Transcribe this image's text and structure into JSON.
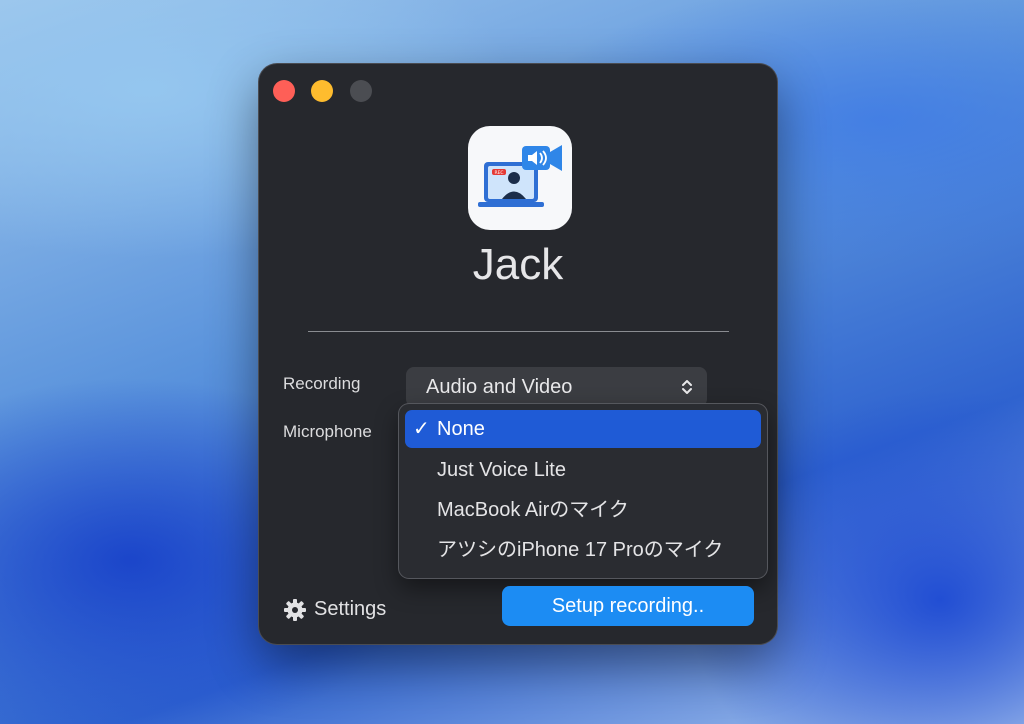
{
  "window": {
    "app_name": "Jack",
    "icon_badge": "REC"
  },
  "form": {
    "recording_label": "Recording",
    "recording_value": "Audio and Video",
    "microphone_label": "Microphone"
  },
  "microphone_menu": {
    "items": [
      {
        "label": "None",
        "selected": true
      },
      {
        "label": "Just Voice Lite",
        "selected": false
      },
      {
        "label": "MacBook Airのマイク",
        "selected": false
      },
      {
        "label": "アツシのiPhone 17 Proのマイク",
        "selected": false
      }
    ],
    "check_glyph": "✓"
  },
  "footer": {
    "settings_label": "Settings",
    "primary_button": "Setup recording.."
  },
  "icons": {
    "settings": "gear-icon",
    "select_arrows": "chevron-up-down-icon",
    "app": "video-recorder-app-icon"
  },
  "colors": {
    "window_bg": "#26282d",
    "accent": "#1c8cf3",
    "menu_selected": "#1f5bd6",
    "close": "#fe5f57",
    "minimize": "#febc2e"
  }
}
